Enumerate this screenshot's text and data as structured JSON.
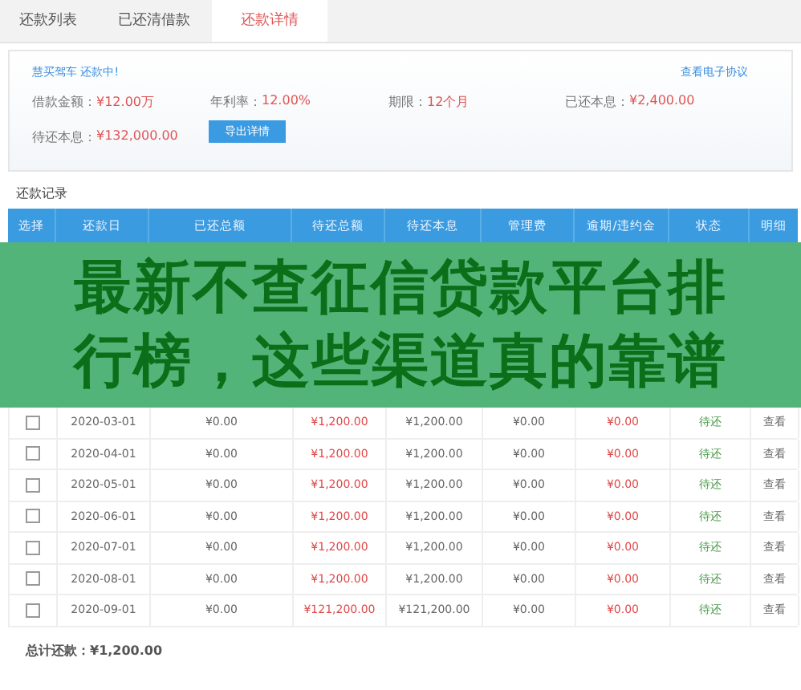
{
  "tabs": [
    {
      "label": "还款列表",
      "selected": false
    },
    {
      "label": "已还清借款",
      "selected": false
    },
    {
      "label": "还款详情",
      "selected": true
    }
  ],
  "summary": {
    "status_line": "慧买驾车 还款中!",
    "agreement_link": "查看电子协议",
    "fields": [
      {
        "label": "借款金额：",
        "value": "¥12.00万"
      },
      {
        "label": "年利率：",
        "value": "12.00%"
      },
      {
        "label": "期限：",
        "value": "12个月"
      },
      {
        "label": "已还本息：",
        "value": "¥2,400.00"
      },
      {
        "label": "待还本息：",
        "value": "¥132,000.00"
      }
    ],
    "export_button": "导出详情"
  },
  "records": {
    "title": "还款记录",
    "columns": [
      "选择",
      "还款日",
      "已还总额",
      "待还总额",
      "待还本息",
      "管理费",
      "逾期/违约金",
      "状态",
      "明细"
    ],
    "rows": [
      {
        "checked": false,
        "date": "2020-03-01",
        "paid": "¥0.00",
        "due_total": "¥1,200.00",
        "due_principal": "¥1,200.00",
        "fee": "¥0.00",
        "penalty": "¥0.00",
        "status": "待还",
        "detail": "查看"
      },
      {
        "checked": false,
        "date": "2020-04-01",
        "paid": "¥0.00",
        "due_total": "¥1,200.00",
        "due_principal": "¥1,200.00",
        "fee": "¥0.00",
        "penalty": "¥0.00",
        "status": "待还",
        "detail": "查看"
      },
      {
        "checked": false,
        "date": "2020-05-01",
        "paid": "¥0.00",
        "due_total": "¥1,200.00",
        "due_principal": "¥1,200.00",
        "fee": "¥0.00",
        "penalty": "¥0.00",
        "status": "待还",
        "detail": "查看"
      },
      {
        "checked": false,
        "date": "2020-06-01",
        "paid": "¥0.00",
        "due_total": "¥1,200.00",
        "due_principal": "¥1,200.00",
        "fee": "¥0.00",
        "penalty": "¥0.00",
        "status": "待还",
        "detail": "查看"
      },
      {
        "checked": false,
        "date": "2020-07-01",
        "paid": "¥0.00",
        "due_total": "¥1,200.00",
        "due_principal": "¥1,200.00",
        "fee": "¥0.00",
        "penalty": "¥0.00",
        "status": "待还",
        "detail": "查看"
      },
      {
        "checked": false,
        "date": "2020-08-01",
        "paid": "¥0.00",
        "due_total": "¥1,200.00",
        "due_principal": "¥1,200.00",
        "fee": "¥0.00",
        "penalty": "¥0.00",
        "status": "待还",
        "detail": "查看"
      },
      {
        "checked": false,
        "date": "2020-09-01",
        "paid": "¥0.00",
        "due_total": "¥121,200.00",
        "due_principal": "¥121,200.00",
        "fee": "¥0.00",
        "penalty": "¥0.00",
        "status": "待还",
        "detail": "查看"
      }
    ],
    "total": "总计还款：¥1,200.00"
  },
  "overlay_banner": {
    "lines": [
      "最新不查征信贷款平台排",
      "行榜，这些渠道真的靠谱"
    ]
  }
}
